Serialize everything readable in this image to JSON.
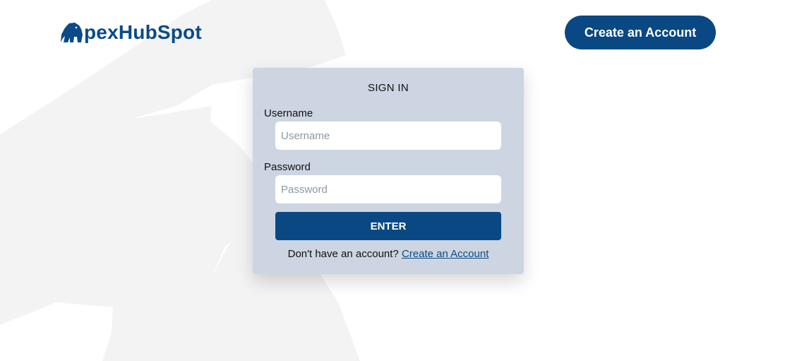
{
  "brand": {
    "name": "pexHubSpot",
    "color": "#0b4a87"
  },
  "header": {
    "cta_label": "Create an Account"
  },
  "signin": {
    "title": "SIGN IN",
    "username_label": "Username",
    "username_placeholder": "Username",
    "username_value": "",
    "password_label": "Password",
    "password_placeholder": "Password",
    "password_value": "",
    "submit_label": "ENTER",
    "signup_prompt": "Don't have an account?",
    "signup_link": "Create an Account"
  },
  "colors": {
    "primary": "#0a4883",
    "card_background": "#ccd5e1",
    "page_background": "#ffffff",
    "watermark": "#f3f3f3"
  },
  "icons": {
    "logo": "gorilla-icon"
  }
}
